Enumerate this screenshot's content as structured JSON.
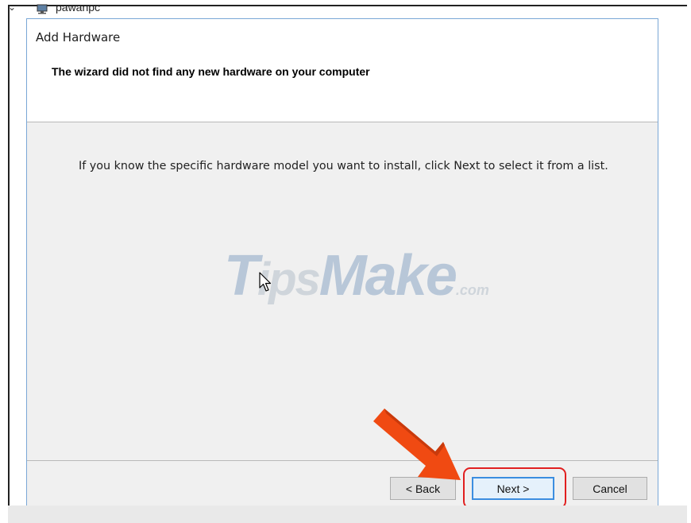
{
  "tree": {
    "expand_glyph": "⌄",
    "computer_label": "pawanpc"
  },
  "wizard": {
    "title": "Add Hardware",
    "heading": "The wizard did not find any new hardware on your computer",
    "body": "If you know the specific hardware model you want to install, click Next to select it from a list.",
    "buttons": {
      "back": "< Back",
      "next": "Next >",
      "cancel": "Cancel"
    }
  },
  "watermark": {
    "first": "T",
    "rest": "ips",
    "brand": "Make",
    "suffix": ".com"
  },
  "colors": {
    "highlight": "#e11f1f",
    "arrow": "#f04a12",
    "accent_border": "#3c8ee0"
  },
  "icons": [
    "chevron-down-icon",
    "computer-icon",
    "mouse-pointer-icon",
    "arrow-annotation-icon"
  ]
}
